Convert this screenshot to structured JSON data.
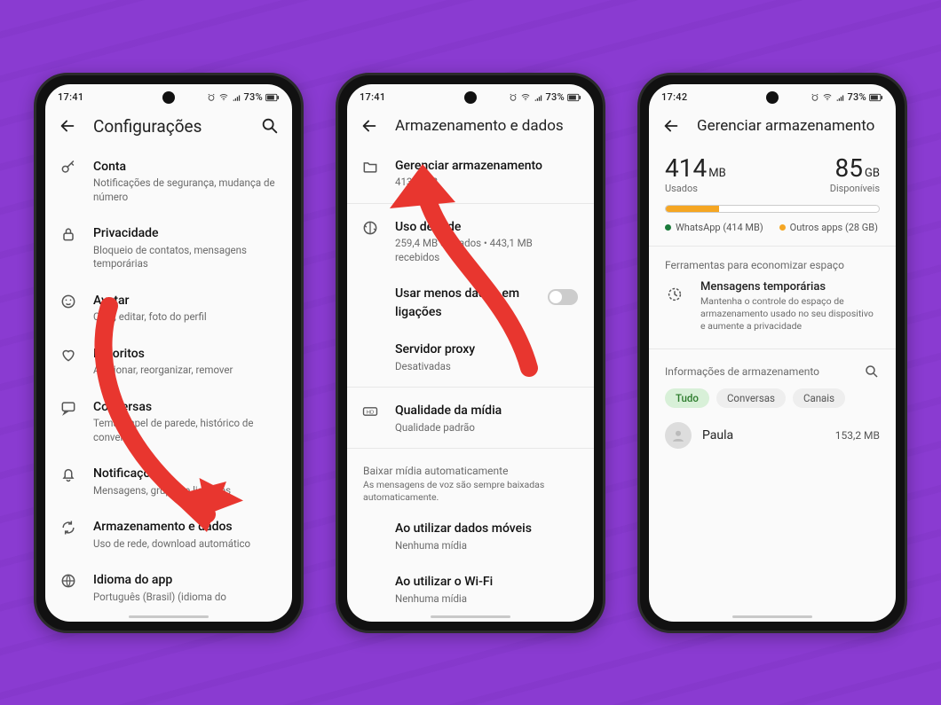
{
  "status": {
    "time1": "17:41",
    "time2": "17:41",
    "time3": "17:42",
    "battery": "73%"
  },
  "screen1": {
    "title": "Configurações",
    "items": [
      {
        "icon": "key",
        "title": "Conta",
        "sub": "Notificações de segurança, mudança de número"
      },
      {
        "icon": "lock",
        "title": "Privacidade",
        "sub": "Bloqueio de contatos, mensagens temporárias"
      },
      {
        "icon": "face",
        "title": "Avatar",
        "sub": "Criar, editar, foto do perfil"
      },
      {
        "icon": "heart",
        "title": "Favoritos",
        "sub": "Adicionar, reorganizar, remover"
      },
      {
        "icon": "chat",
        "title": "Conversas",
        "sub": "Tema, papel de parede, histórico de conversas"
      },
      {
        "icon": "bell",
        "title": "Notificações",
        "sub": "Mensagens, grupos e ligações"
      },
      {
        "icon": "sync",
        "title": "Armazenamento e dados",
        "sub": "Uso de rede, download automático"
      },
      {
        "icon": "globe",
        "title": "Idioma do app",
        "sub": "Português (Brasil) (idioma do"
      }
    ]
  },
  "screen2": {
    "title": "Armazenamento e dados",
    "manage": {
      "title": "Gerenciar armazenamento",
      "sub": "413,7 MB"
    },
    "network": {
      "title": "Uso de rede",
      "sub": "259,4 MB enviados • 443,1 MB recebidos"
    },
    "lessdata": {
      "title": "Usar menos dados em ligações"
    },
    "proxy": {
      "title": "Servidor proxy",
      "sub": "Desativadas"
    },
    "media": {
      "title": "Qualidade da mídia",
      "sub": "Qualidade padrão"
    },
    "auto_header": "Baixar mídia automaticamente",
    "auto_desc": "As mensagens de voz são sempre baixadas automaticamente.",
    "auto_items": [
      {
        "title": "Ao utilizar dados móveis",
        "sub": "Nenhuma mídia"
      },
      {
        "title": "Ao utilizar o Wi-Fi",
        "sub": "Nenhuma mídia"
      }
    ]
  },
  "screen3": {
    "title": "Gerenciar armazenamento",
    "used_val": "414",
    "used_unit": "MB",
    "used_label": "Usados",
    "avail_val": "85",
    "avail_unit": "GB",
    "avail_label": "Disponíveis",
    "legend_wa": "WhatsApp (414 MB)",
    "legend_other": "Outros apps (28 GB)",
    "tools_header": "Ferramentas para economizar espaço",
    "tools_title": "Mensagens temporárias",
    "tools_sub": "Mantenha o controle do espaço de armazenamento usado no seu dispositivo e aumente a privacidade",
    "info_header": "Informações de armazenamento",
    "chips": [
      "Tudo",
      "Conversas",
      "Canais"
    ],
    "contact_name": "Paula",
    "contact_size": "153,2 MB"
  },
  "colors": {
    "accent": "#f5a623"
  }
}
